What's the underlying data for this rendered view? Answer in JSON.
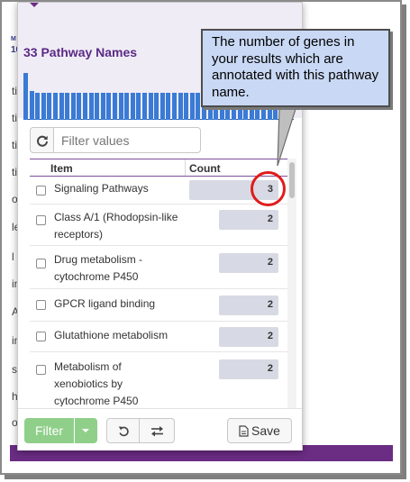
{
  "background": {
    "header_fragments": [
      "M",
      "10"
    ],
    "row_letters": [
      "ti",
      "ti",
      "ti",
      "ti",
      "o",
      "le",
      "l",
      "in",
      "A",
      "in",
      "s",
      "h",
      "o"
    ]
  },
  "popup": {
    "title": "33 Pathway Names",
    "histogram_bar_heights": [
      1.0,
      0.62,
      0.58,
      0.58,
      0.58,
      0.58,
      0.58,
      0.58,
      0.58,
      0.58,
      0.58,
      0.58,
      0.58,
      0.58,
      0.58,
      0.58,
      0.58,
      0.58,
      0.58,
      0.58,
      0.58,
      0.58,
      0.58,
      0.58,
      0.58,
      0.58,
      0.58,
      0.58,
      0.58,
      0.58,
      0.58,
      0.58,
      0.58,
      0.58,
      0.58,
      0.58,
      0.58,
      0.58,
      0.58,
      0.58,
      0.58,
      0.58,
      0.58,
      0.58,
      0.58
    ],
    "filter_placeholder": "Filter values",
    "columns": {
      "item": "Item",
      "count": "Count"
    },
    "rows": [
      {
        "item": "Signaling Pathways",
        "count": "3",
        "bar_fraction": 1.0
      },
      {
        "item": "Class A/1 (Rhodopsin-like receptors)",
        "count": "2",
        "bar_fraction": 0.67
      },
      {
        "item": "Drug metabolism - cytochrome P450",
        "count": "2",
        "bar_fraction": 0.67
      },
      {
        "item": "GPCR ligand binding",
        "count": "2",
        "bar_fraction": 0.67
      },
      {
        "item": "Glutathione metabolism",
        "count": "2",
        "bar_fraction": 0.67
      },
      {
        "item": "Metabolism of xenobiotics by cytochrome P450",
        "count": "2",
        "bar_fraction": 0.67
      }
    ],
    "footer": {
      "filter_label": "Filter",
      "save_label": "Save"
    }
  },
  "callout": {
    "text": "The number of genes in your results which are annotated with this pathway name."
  },
  "colors": {
    "accent": "#6b2c84",
    "title": "#5a2a86",
    "histogram": "#3a7bd5",
    "count_bar": "#d7dae4",
    "filter_button": "#8fcf8a",
    "callout_bg": "#c9d8f4",
    "highlight_ring": "#e01b1b"
  }
}
